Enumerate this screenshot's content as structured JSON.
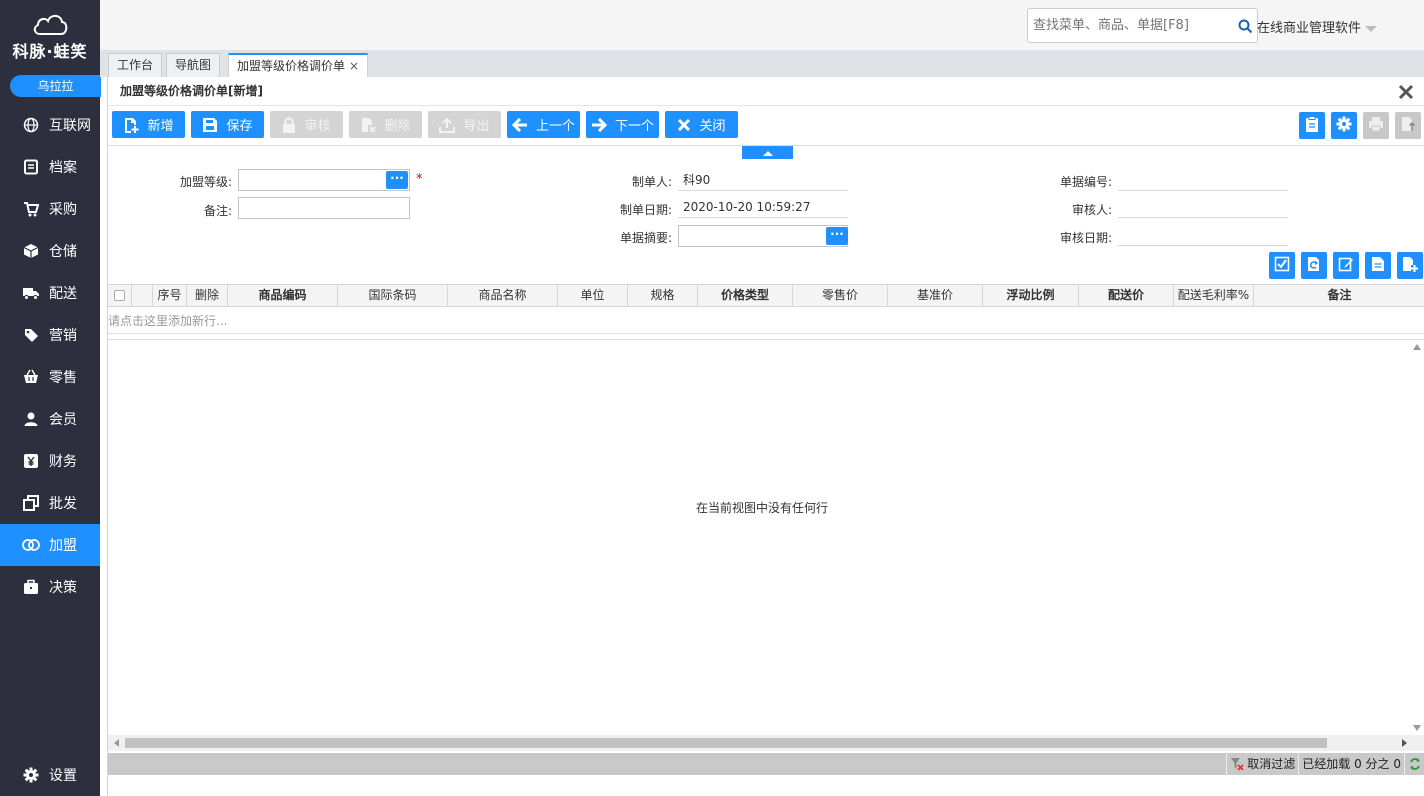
{
  "brand": {
    "name": "科脉·蛙笑",
    "user": "乌拉拉"
  },
  "sidebar": {
    "items": [
      {
        "label": "互联网",
        "icon": "globe-icon"
      },
      {
        "label": "档案",
        "icon": "file-icon"
      },
      {
        "label": "采购",
        "icon": "cart-icon"
      },
      {
        "label": "仓储",
        "icon": "box-icon"
      },
      {
        "label": "配送",
        "icon": "truck-icon"
      },
      {
        "label": "营销",
        "icon": "tag-icon"
      },
      {
        "label": "零售",
        "icon": "basket-icon"
      },
      {
        "label": "会员",
        "icon": "user-icon"
      },
      {
        "label": "财务",
        "icon": "yen-icon"
      },
      {
        "label": "批发",
        "icon": "copy-icon"
      },
      {
        "label": "加盟",
        "icon": "rings-icon",
        "active": true
      },
      {
        "label": "决策",
        "icon": "briefcase-icon"
      }
    ],
    "settings": {
      "label": "设置",
      "icon": "gear-icon"
    }
  },
  "header": {
    "search_placeholder": "查找菜单、商品、单据[F8]",
    "app_title": "在线商业管理软件"
  },
  "tabs": [
    {
      "label": "工作台"
    },
    {
      "label": "导航图"
    },
    {
      "label": "加盟等级价格调价单",
      "active": true,
      "close": "×"
    }
  ],
  "window": {
    "title": "加盟等级价格调价单[新增]",
    "toolbar": {
      "new": "新增",
      "save": "保存",
      "audit": "审核",
      "delete": "删除",
      "export": "导出",
      "prev": "上一个",
      "next": "下一个",
      "close": "关闭"
    },
    "form": {
      "level_label": "加盟等级:",
      "level_value": "",
      "required_mark": "*",
      "remark_label": "备注:",
      "remark_value": "",
      "creator_label": "制单人:",
      "creator_value": "科90",
      "date_label": "制单日期:",
      "date_value": "2020-10-20 10:59:27",
      "summary_label": "单据摘要:",
      "summary_value": "",
      "docno_label": "单据编号:",
      "docno_value": "",
      "auditor_label": "审核人:",
      "auditor_value": "",
      "audit_date_label": "审核日期:",
      "audit_date_value": "",
      "dots": "···"
    },
    "grid": {
      "columns": [
        "序号",
        "删除",
        "商品编码",
        "国际条码",
        "商品名称",
        "单位",
        "规格",
        "价格类型",
        "零售价",
        "基准价",
        "浮动比例",
        "配送价",
        "配送毛利率%",
        "备注"
      ],
      "add_row_hint": "请点击这里添加新行...",
      "empty_message": "在当前视图中没有任何行"
    },
    "status": {
      "cancel_filter": "取消过滤",
      "loaded": "已经加载 0 分之 0"
    }
  },
  "colors": {
    "accent": "#1e90ff",
    "sidebar_bg": "#2e2f3e",
    "disabled": "#d4d4d4"
  }
}
